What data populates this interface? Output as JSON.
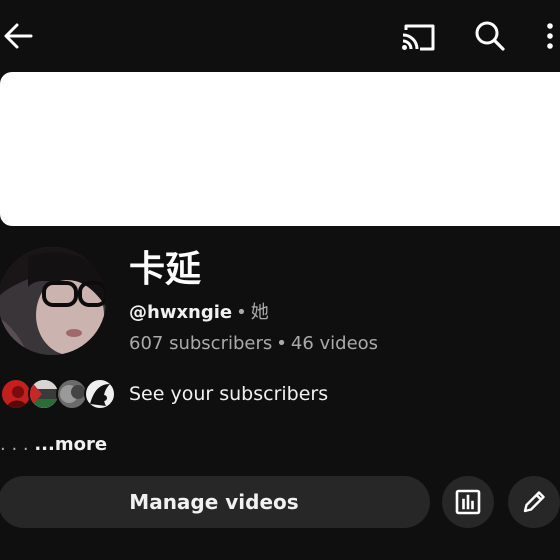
{
  "header": {
    "back_icon": "arrow-left-icon",
    "cast_icon": "cast-icon",
    "search_icon": "search-icon",
    "more_icon": "more-vertical-icon"
  },
  "banner": {
    "color": "#ffffff"
  },
  "channel": {
    "name": "卡延",
    "handle": "@hwxngie",
    "separator": "•",
    "pronoun": "她",
    "subscribers": "607 subscribers",
    "videos": "46 videos"
  },
  "subscribers_preview": {
    "label": "See your subscribers",
    "avatars": [
      "red-avatar",
      "flag-avatar",
      "gray-avatar",
      "bw-avatar"
    ]
  },
  "description": {
    "dots": ". . . ",
    "more_label": "...more"
  },
  "actions": {
    "manage_label": "Manage videos",
    "analytics_icon": "analytics-icon",
    "edit_icon": "edit-pencil-icon"
  },
  "colors": {
    "background": "#0f0f0f",
    "button_bg": "#272727",
    "secondary_text": "#aaaaaa",
    "primary_text": "#f1f1f1"
  }
}
